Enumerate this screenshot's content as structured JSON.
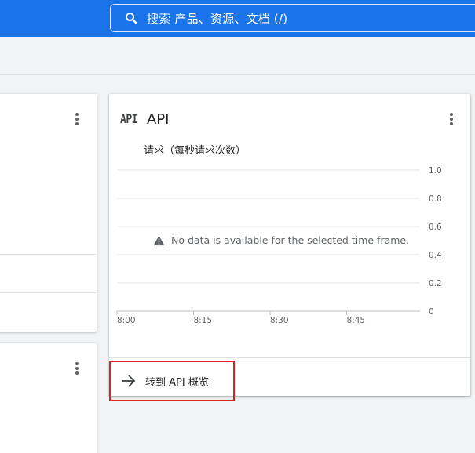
{
  "search": {
    "placeholder": "搜索  产品、资源、文档 (/)"
  },
  "api_card": {
    "icon_text": "API",
    "title": "API",
    "link_label": "转到 API 概览"
  },
  "chart_data": {
    "type": "line",
    "title": "请求（每秒请求次数）",
    "x": [
      "8:00",
      "8:15",
      "8:30",
      "8:45"
    ],
    "y_ticks": [
      "1.0",
      "0.8",
      "0.6",
      "0.4",
      "0.2",
      "0"
    ],
    "ylim": [
      0,
      1.0
    ],
    "grid": true,
    "series": [],
    "annotation": "No data is available for the selected time frame."
  },
  "colors": {
    "brand_blue": "#1a73e8",
    "highlight_red": "#e02020"
  },
  "icons": [
    "search-icon",
    "more-vert-icon",
    "api-icon",
    "warning-icon",
    "arrow-forward-icon"
  ]
}
